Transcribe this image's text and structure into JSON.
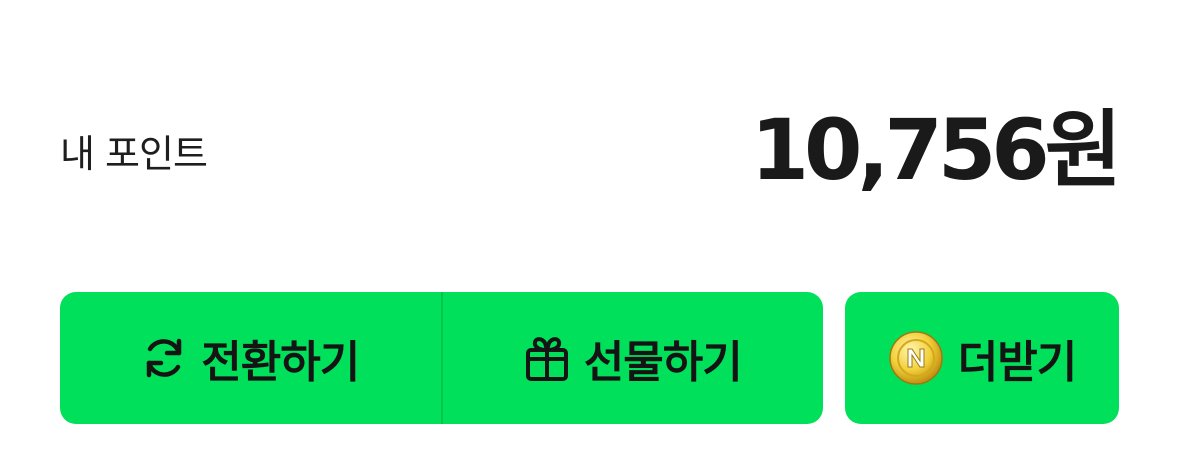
{
  "points": {
    "label": "내 포인트",
    "value": "10,756원"
  },
  "actions": {
    "convert": {
      "label": "전환하기",
      "icon": "refresh-icon"
    },
    "gift": {
      "label": "선물하기",
      "icon": "gift-icon"
    },
    "earn_more": {
      "label": "더받기",
      "icon": "n-coin-icon"
    }
  },
  "colors": {
    "button_green": "#00e05a",
    "text_dark": "#1a1a1a"
  }
}
